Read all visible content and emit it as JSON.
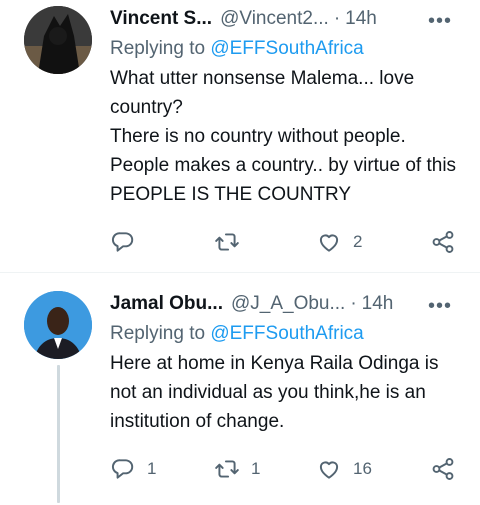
{
  "tweets": [
    {
      "name": "Vincent S...",
      "handle": "@Vincent2...",
      "sep": "·",
      "time": "14h",
      "more": "•••",
      "replying_prefix": "Replying to ",
      "replying_to": "@EFFSouthAfrica",
      "lines": [
        "What utter nonsense Malema... love country?",
        "There is no country without people. People makes a country.. by virtue of this PEOPLE IS THE COUNTRY"
      ],
      "actions": {
        "reply_count": "",
        "retweet_count": "",
        "like_count": "2"
      }
    },
    {
      "name": "Jamal Obu...",
      "handle": "@J_A_Obu...",
      "sep": "·",
      "time": "14h",
      "more": "•••",
      "replying_prefix": "Replying to ",
      "replying_to": "@EFFSouthAfrica",
      "lines": [
        "Here at home in Kenya Raila Odinga is not an individual as you think,he is an institution of change."
      ],
      "actions": {
        "reply_count": "1",
        "retweet_count": "1",
        "like_count": "16"
      }
    }
  ],
  "icons": [
    "reply-icon",
    "retweet-icon",
    "like-icon",
    "share-icon",
    "more-icon"
  ],
  "colors": {
    "link": "#1d9bf0",
    "secondary": "#536471",
    "text": "#0f1419"
  }
}
